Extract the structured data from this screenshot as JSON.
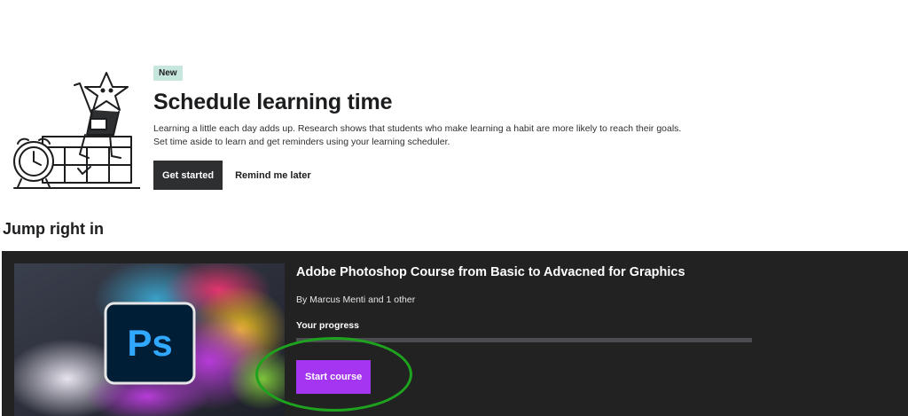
{
  "banner": {
    "badge": "New",
    "title": "Schedule learning time",
    "description_line1": "Learning a little each day adds up. Research shows that students who make learning a habit are more likely to reach their goals.",
    "description_line2": "Set time aside to learn and get reminders using your learning scheduler.",
    "primary_button": "Get started",
    "secondary_button": "Remind me later"
  },
  "section": {
    "title": "Jump right in"
  },
  "course": {
    "title": "Adobe Photoshop Course from Basic to Advacned for Graphics",
    "authors": "By Marcus Menti and 1 other",
    "progress_label": "Your progress",
    "progress_fraction": 0,
    "start_button": "Start course",
    "thumbnail_logo_text": "Ps"
  },
  "colors": {
    "accent": "#a435f0",
    "badge_bg": "#c7e6de",
    "card_bg": "#222223",
    "highlight_ring": "#1ea31e"
  }
}
